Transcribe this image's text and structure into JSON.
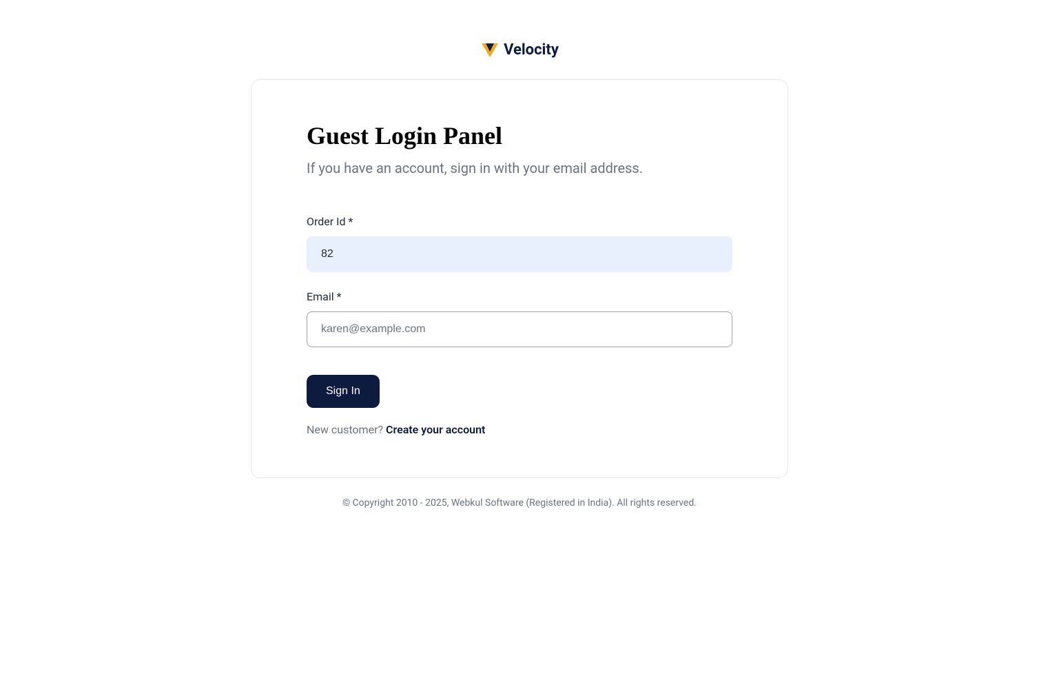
{
  "brand": {
    "name": "Velocity"
  },
  "panel": {
    "title": "Guest Login Panel",
    "subtitle": "If you have an account, sign in with your email address."
  },
  "form": {
    "order_id_label": "Order Id *",
    "order_id_value": "82",
    "email_label": "Email *",
    "email_placeholder": "karen@example.com",
    "email_value": "",
    "sign_in_label": "Sign In"
  },
  "footer_panel": {
    "new_customer_text": "New customer? ",
    "create_account_label": "Create your account"
  },
  "footer": {
    "copyright": "© Copyright 2010 - 2025, Webkul Software (Registered in India). All rights reserved."
  }
}
